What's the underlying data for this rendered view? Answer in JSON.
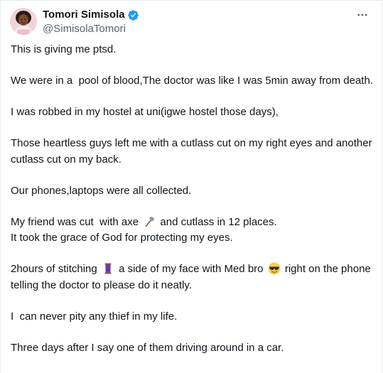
{
  "tweet": {
    "display_name": "Tomori Simisola",
    "handle": "@SimisolaTomori",
    "more_icon": "more-horizontal-icon",
    "verified_icon": "verified-badge-icon",
    "verified_color": "#1d9bf0",
    "lines": {
      "l1": "This is giving me ptsd.",
      "l2": "We were in a  pool of blood,The doctor was like I was 5min away from death.",
      "l3": "I was robbed in my hostel at uni(igwe hostel those days),",
      "l4": "Those heartless guys left me with a cutlass cut on my right eyes and another cutlass cut on my back.",
      "l5": "Our phones,laptops were all collected.",
      "l6a": "My friend was cut  with axe ",
      "l6b": " and cutlass in 12 places.",
      "l7": "It took the grace of God for protecting my eyes.",
      "l8a": "2hours of stitching ",
      "l8b": " a side of my face with Med bro ",
      "l8c": " right on the phone telling the doctor to please do it neatly.",
      "l9": "I  can never pity any thief in my life.",
      "l10": "Three days after I say one of them driving around in a car."
    },
    "emojis": {
      "axe": "axe-emoji",
      "thread": "thread-spool-emoji",
      "sunglasses": "smiling-face-with-sunglasses-emoji"
    }
  }
}
